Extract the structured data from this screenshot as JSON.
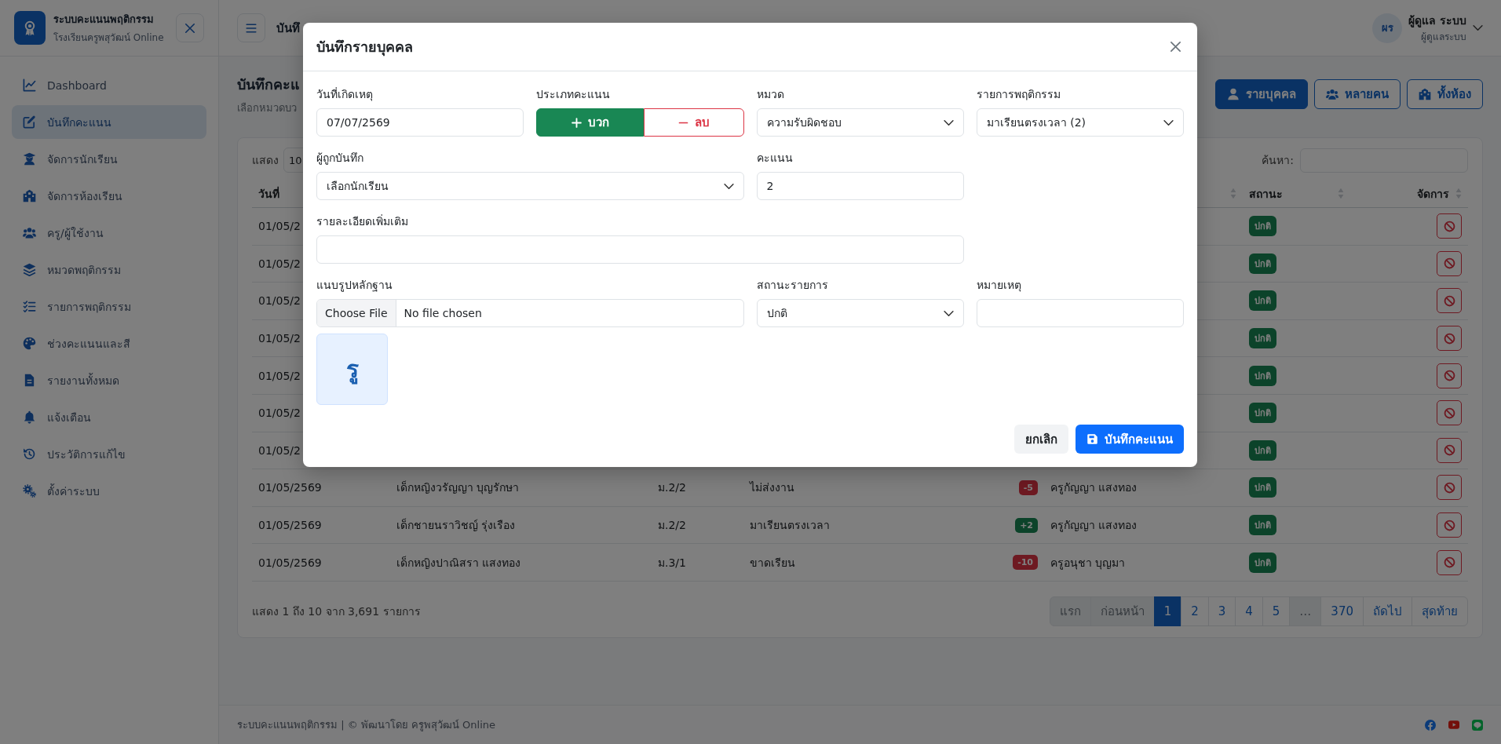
{
  "sidebar": {
    "brand": {
      "title": "ระบบคะแนนพฤติกรรม",
      "subtitle": "โรงเรียนครูพสุวัฒน์ Online"
    },
    "items": [
      {
        "label": "Dashboard",
        "selected": false
      },
      {
        "label": "บันทึกคะแนน",
        "selected": true
      },
      {
        "label": "จัดการนักเรียน",
        "selected": false
      },
      {
        "label": "จัดการห้องเรียน",
        "selected": false
      },
      {
        "label": "ครู/ผู้ใช้งาน",
        "selected": false
      },
      {
        "label": "หมวดพฤติกรรม",
        "selected": false
      },
      {
        "label": "รายการพฤติกรรม",
        "selected": false
      },
      {
        "label": "ช่วงคะแนนและสี",
        "selected": false
      },
      {
        "label": "รายงานทั้งหมด",
        "selected": false
      },
      {
        "label": "แจ้งเตือน",
        "selected": false
      },
      {
        "label": "ประวัติการแก้ไข",
        "selected": false
      },
      {
        "label": "ตั้งค่าระบบ",
        "selected": false
      }
    ]
  },
  "topbar": {
    "title": "บันทึ",
    "user": {
      "initials": "ผร",
      "name": "ผู้ดูแล ระบบ",
      "role": "ผู้ดูแลระบบ"
    }
  },
  "page": {
    "title": "บันทึกคะแ",
    "subtitle": "เลือกหมวดบว",
    "actions": [
      {
        "label": "รายบุคคล",
        "selected": true
      },
      {
        "label": "หลายคน",
        "selected": false
      },
      {
        "label": "ทั้งห้อง",
        "selected": false
      }
    ]
  },
  "table": {
    "length_label": "แสดง",
    "length_value": "10",
    "search_label": "ค้นหา:",
    "columns": [
      {
        "label": "วันที่"
      },
      null,
      null,
      null,
      null,
      {
        "sortable": true
      },
      {
        "label": "สถานะ",
        "sortable": true
      },
      {
        "label": "จัดการ",
        "sortable": true
      }
    ],
    "rows": [
      {
        "date": "01/05/2",
        "status": "ปกติ"
      },
      {
        "date": "01/05/2",
        "status": "ปกติ"
      },
      {
        "date": "01/05/2",
        "status": "ปกติ"
      },
      {
        "date": "01/05/2",
        "status": "ปกติ"
      },
      {
        "date": "01/05/2",
        "status": "ปกติ"
      },
      {
        "date": "01/05/2",
        "status": "ปกติ"
      },
      {
        "date": "01/05/2",
        "status": "ปกติ"
      },
      {
        "date": "01/05/2569",
        "student": "เด็กหญิงวรัญญา บุญรักษา",
        "class": "ม.2/2",
        "behavior": "ไม่ส่งงาน",
        "score": {
          "text": "-5",
          "kind": "minus"
        },
        "teacher": "ครูกัญญา แสงทอง",
        "status": "ปกติ"
      },
      {
        "date": "01/05/2569",
        "student": "เด็กชายนราวิชญ์ รุ่งเรือง",
        "class": "ม.2/2",
        "behavior": "มาเรียนตรงเวลา",
        "score": {
          "text": "+2",
          "kind": "plus"
        },
        "teacher": "ครูกัญญา แสงทอง",
        "status": "ปกติ"
      },
      {
        "date": "01/05/2569",
        "student": "เด็กหญิงปาณิสรา แสงทอง",
        "class": "ม.3/1",
        "behavior": "ขาดเรียน",
        "score": {
          "text": "-10",
          "kind": "minus"
        },
        "teacher": "ครูอนุชา บุญมา",
        "status": "ปกติ"
      }
    ],
    "info": "แสดง 1 ถึง 10 จาก 3,691 รายการ",
    "pagination": [
      {
        "label": "แรก",
        "selected": false,
        "disabled": true
      },
      {
        "label": "ก่อนหน้า",
        "selected": false,
        "disabled": true
      },
      {
        "label": "1",
        "selected": true,
        "disabled": false
      },
      {
        "label": "2",
        "selected": false,
        "disabled": false
      },
      {
        "label": "3",
        "selected": false,
        "disabled": false
      },
      {
        "label": "4",
        "selected": false,
        "disabled": false
      },
      {
        "label": "5",
        "selected": false,
        "disabled": false
      },
      {
        "label": "…",
        "selected": false,
        "disabled": true
      },
      {
        "label": "370",
        "selected": false,
        "disabled": false
      },
      {
        "label": "ถัดไป",
        "selected": false,
        "disabled": false
      },
      {
        "label": "สุดท้าย",
        "selected": false,
        "disabled": false
      }
    ]
  },
  "modal": {
    "title": "บันทึกรายบุคคล",
    "date": {
      "label": "วันที่เกิดเหตุ",
      "value": "07/07/2569"
    },
    "score_type": {
      "label": "ประเภทคะแนน",
      "options": [
        {
          "label": "บวก",
          "kind": "plus",
          "selected": true
        },
        {
          "label": "ลบ",
          "kind": "minus",
          "selected": false
        }
      ]
    },
    "category": {
      "label": "หมวด",
      "value": "ความรับผิดชอบ"
    },
    "behavior": {
      "label": "รายการพฤติกรรม",
      "value": "มาเรียนตรงเวลา (2)"
    },
    "student": {
      "label": "ผู้ถูกบันทึก",
      "value": "เลือกนักเรียน"
    },
    "points": {
      "label": "คะแนน",
      "value": "2"
    },
    "details": {
      "label": "รายละเอียดเพิ่มเติม"
    },
    "evidence": {
      "label": "แนบรูปหลักฐาน",
      "button": "Choose File",
      "value": "No file chosen",
      "preview": "รู"
    },
    "status": {
      "label": "สถานะรายการ",
      "value": "ปกติ"
    },
    "note": {
      "label": "หมายเหตุ"
    },
    "buttons": [
      {
        "label": "ยกเลิก",
        "kind": "secondary"
      },
      {
        "label": "บันทึกคะแนน",
        "kind": "primary"
      }
    ]
  },
  "footer": {
    "text": "ระบบคะแนนพฤติกรรม | © พัฒนาโดย ครูพสุวัฒน์ Online"
  }
}
